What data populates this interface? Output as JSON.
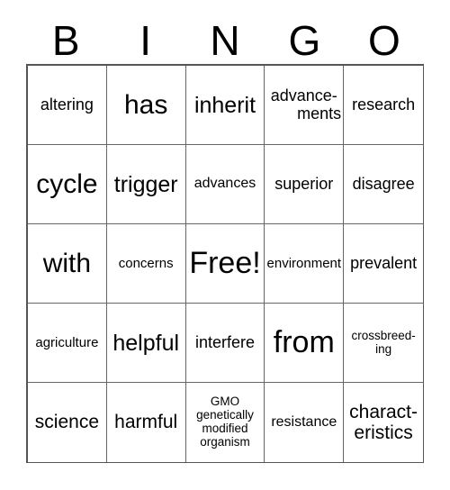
{
  "card": {
    "title": "BINGO",
    "header_letters": [
      "B",
      "I",
      "N",
      "G",
      "O"
    ],
    "grid_size": "5x5",
    "free_space": "Free!",
    "colors": {
      "text": "#000000",
      "background": "#ffffff",
      "grid_line": "#666666",
      "grid_border": "#555555"
    }
  },
  "rows": [
    {
      "cells": [
        {
          "text": "altering",
          "size": "md",
          "lines": [
            "altering"
          ]
        },
        {
          "text": "has",
          "size": "xxl",
          "lines": [
            "has"
          ]
        },
        {
          "text": "inherit",
          "size": "xl",
          "lines": [
            "inherit"
          ]
        },
        {
          "text": "advance-ments",
          "size": "md",
          "lines": [
            "advance-",
            "ments"
          ],
          "wrap": "hyphen-right"
        },
        {
          "text": "research",
          "size": "md",
          "lines": [
            "research"
          ]
        }
      ]
    },
    {
      "cells": [
        {
          "text": "cycle",
          "size": "xxl",
          "lines": [
            "cycle"
          ]
        },
        {
          "text": "trigger",
          "size": "xl",
          "lines": [
            "trigger"
          ]
        },
        {
          "text": "advances",
          "size": "smm",
          "lines": [
            "advances"
          ]
        },
        {
          "text": "superior",
          "size": "md",
          "lines": [
            "superior"
          ]
        },
        {
          "text": "disagree",
          "size": "md",
          "lines": [
            "disagree"
          ]
        }
      ]
    },
    {
      "cells": [
        {
          "text": "with",
          "size": "xxl",
          "lines": [
            "with"
          ]
        },
        {
          "text": "concerns",
          "size": "sm",
          "lines": [
            "concerns"
          ]
        },
        {
          "text": "Free!",
          "size": "huge",
          "lines": [
            "Free!"
          ]
        },
        {
          "text": "environment",
          "size": "sm",
          "lines": [
            "environment"
          ]
        },
        {
          "text": "prevalent",
          "size": "md",
          "lines": [
            "prevalent"
          ]
        }
      ]
    },
    {
      "cells": [
        {
          "text": "agriculture",
          "size": "sm",
          "lines": [
            "agriculture"
          ]
        },
        {
          "text": "helpful",
          "size": "xl",
          "lines": [
            "helpful"
          ]
        },
        {
          "text": "interfere",
          "size": "md",
          "lines": [
            "interfere"
          ]
        },
        {
          "text": "from",
          "size": "huge",
          "lines": [
            "from"
          ]
        },
        {
          "text": "crossbreed-ing",
          "size": "xs",
          "lines": [
            "crossbreed-",
            "ing"
          ],
          "wrap": "hyphen-center"
        }
      ]
    },
    {
      "cells": [
        {
          "text": "science",
          "size": "lg",
          "lines": [
            "science"
          ]
        },
        {
          "text": "harmful",
          "size": "lg",
          "lines": [
            "harmful"
          ]
        },
        {
          "text": "GMO genetically modified organism",
          "size": "xs",
          "lines": [
            "GMO",
            "genetically",
            "modified",
            "organism"
          ],
          "wrap": "stack"
        },
        {
          "text": "resistance",
          "size": "smm",
          "lines": [
            "resistance"
          ]
        },
        {
          "text": "charact-eristics",
          "size": "lg",
          "lines": [
            "charact-",
            "eristics"
          ],
          "wrap": "hyphen-center"
        }
      ]
    }
  ]
}
